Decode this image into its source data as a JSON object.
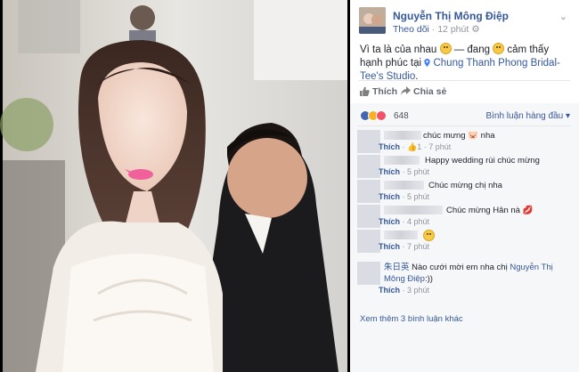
{
  "post": {
    "author": "Nguyễn Thị Mông Điệp",
    "follow": "Theo dõi",
    "time": "12 phút",
    "text_part1": "Vì ta là của nhau",
    "text_part2": "— đang",
    "text_part3": "cảm thấy hạnh phúc tại",
    "location": "Chung Thanh Phong Bridal- Tee's Studio",
    "text_end": "."
  },
  "actions": {
    "like": "Thích",
    "share": "Chia sẻ"
  },
  "reactions": {
    "count": "648",
    "sort_label": "Bình luận hàng đầu"
  },
  "comments": [
    {
      "name": "",
      "text": "chúc mưng",
      "like": "Thích",
      "likes": "1",
      "time": "7 phút"
    },
    {
      "name": "",
      "text": "Happy wedding rùi chúc mừng",
      "like": "Thích",
      "time": "5 phút"
    },
    {
      "name": "",
      "text": "Chúc mừng chị nha",
      "like": "Thích",
      "time": "5 phút"
    },
    {
      "name": "",
      "text": "Chúc mừng Hân nà",
      "like": "Thích",
      "time": "4 phút"
    },
    {
      "name": "",
      "text": "",
      "like": "Thích",
      "time": "7 phút"
    },
    {
      "name": "朱日英",
      "text": "Nào cưới mời em nha chị",
      "mention": "Nguyễn Thị Mông Điệp",
      "text_end": ":))",
      "like": "Thích",
      "time": "3 phút"
    }
  ],
  "more_comments": "Xem thêm 3 bình luận khác",
  "icons": {
    "thumb": "thumbs-up-icon",
    "share": "share-arrow-icon",
    "pin": "location-pin-icon",
    "emoji": "smiley-icon"
  },
  "colors": {
    "link": "#365899",
    "meta": "#90949c",
    "comment_bg": "#f6f7f9"
  }
}
